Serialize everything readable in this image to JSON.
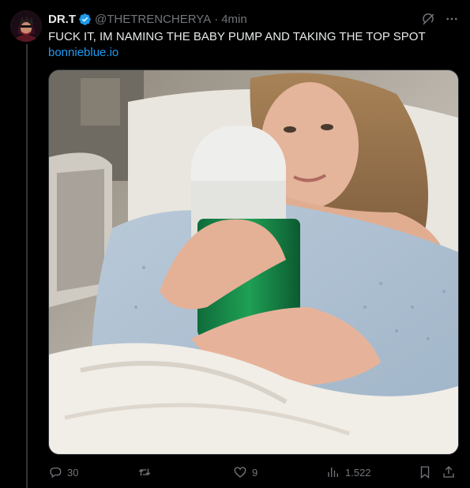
{
  "tweet": {
    "author_name": "DR.T",
    "handle": "@THETRENCHERYA",
    "separator": "·",
    "time": "4min",
    "text": "FUCK IT, IM NAMING THE BABY PUMP AND TAKING THE TOP SPOT",
    "link": "bonnieblue.io"
  },
  "actions": {
    "replies": "30",
    "likes": "9",
    "views": "1.522"
  },
  "icons": {
    "verified": "verified-badge-icon",
    "grok": "grok-icon",
    "more": "more-icon",
    "reply": "reply-icon",
    "retweet": "retweet-icon",
    "like": "like-icon",
    "views": "views-icon",
    "bookmark": "bookmark-icon",
    "share": "share-icon"
  },
  "colors": {
    "background": "#000000",
    "text": "#e7e9ea",
    "muted": "#71767b",
    "accent": "#1d9bf0"
  }
}
